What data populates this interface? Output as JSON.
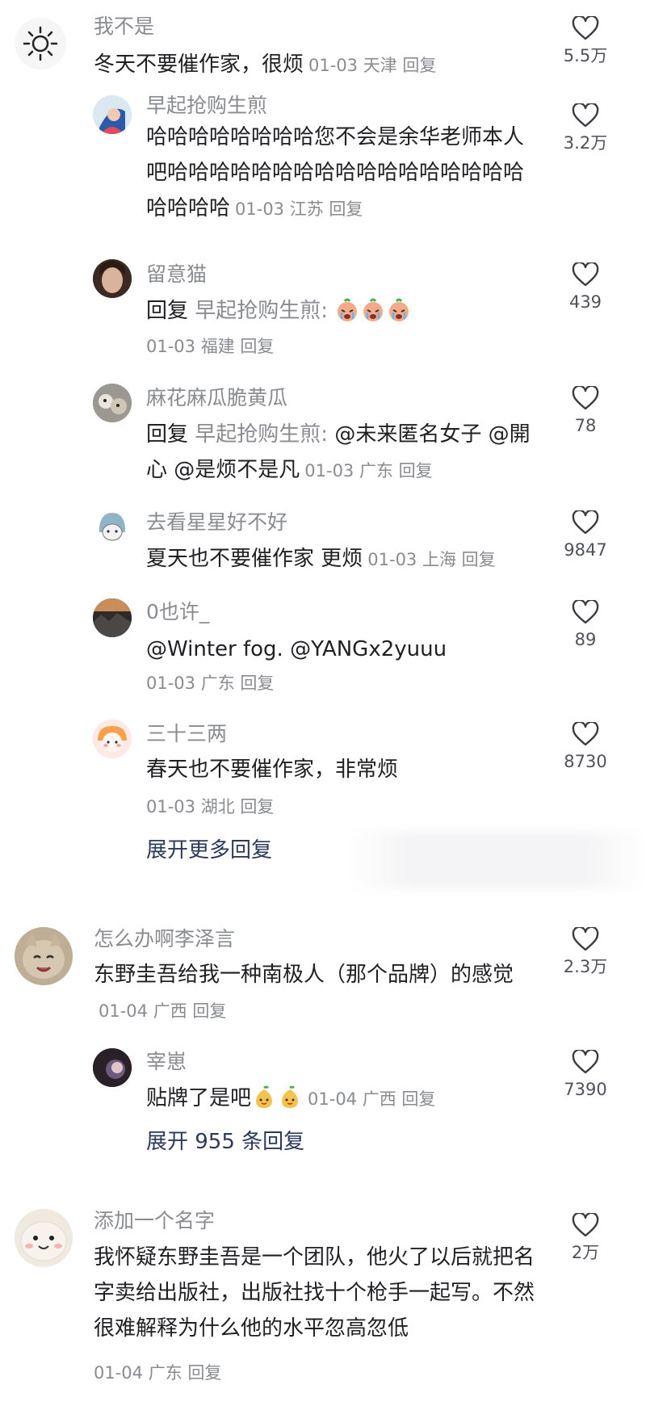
{
  "comments": [
    {
      "username": "我不是",
      "text": "冬天不要催作家，很烦",
      "meta": "01-03 天津 回复",
      "likes": "5.5万"
    },
    {
      "username": "早起抢购生煎",
      "text": "哈哈哈哈哈哈哈哈您不会是余华老师本人吧哈哈哈哈哈哈哈哈哈哈哈哈哈哈哈哈哈哈哈哈哈",
      "meta": "01-03 江苏 回复",
      "likes": "3.2万"
    },
    {
      "username": "留意猫",
      "reply_prefix": "回复",
      "reply_target": "早起抢购生煎:",
      "meta": "01-03 福建 回复",
      "likes": "439"
    },
    {
      "username": "麻花麻瓜脆黄瓜",
      "reply_prefix": "回复",
      "reply_target": "早起抢购生煎:",
      "mentions": "@未来匿名女子 @開心 @是烦不是凡",
      "meta": "01-03 广东 回复",
      "likes": "78"
    },
    {
      "username": "去看星星好不好",
      "text": "夏天也不要催作家 更烦",
      "meta": "01-03 上海 回复",
      "likes": "9847"
    },
    {
      "username": "0也许_",
      "text": "@Winter fog. @YANGx2yuuu",
      "meta": "01-03 广东 回复",
      "likes": "89"
    },
    {
      "username": "三十三两",
      "text": "春天也不要催作家，非常烦",
      "meta": "01-03 湖北 回复",
      "likes": "8730"
    },
    {
      "username": "怎么办啊李泽言",
      "text": "东野圭吾给我一种南极人（那个品牌）的感觉",
      "meta": "01-04 广西 回复",
      "likes": "2.3万"
    },
    {
      "username": "宰崽",
      "text": "贴牌了是吧",
      "meta": "01-04 广西 回复",
      "likes": "7390"
    },
    {
      "username": "添加一个名字",
      "text": "我怀疑东野圭吾是一个团队，他火了以后就把名字卖给出版社，出版社找十个枪手一起写。不然很难解释为什么他的水平忽高忽低",
      "meta": "01-04 广东 回复",
      "likes": "2万"
    }
  ],
  "expand": {
    "more_replies": "展开更多回复",
    "replies_955": "展开 955 条回复"
  },
  "icons": {
    "like": "heart-outline-icon",
    "emoji_crying": "crying-face-emoji",
    "emoji_pear": "pear-emoji"
  },
  "colors": {
    "username": "#8a8b91",
    "text": "#1f1f24",
    "expand": "#2b3a5c"
  }
}
